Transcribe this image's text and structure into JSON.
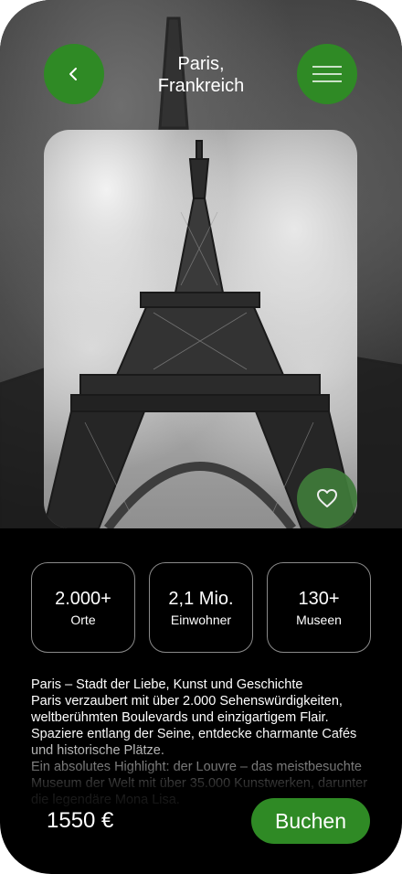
{
  "header": {
    "title_line1": "Paris,",
    "title_line2": "Frankreich"
  },
  "icons": {
    "back": "chevron-left-icon",
    "menu": "hamburger-menu-icon",
    "favorite": "heart-outline-icon"
  },
  "colors": {
    "accent": "#2f8a25",
    "background": "#000000",
    "text": "#ffffff"
  },
  "stats": [
    {
      "value": "2.000+",
      "label": "Orte"
    },
    {
      "value": "2,1 Mio.",
      "label": "Einwohner"
    },
    {
      "value": "130+",
      "label": "Museen"
    }
  ],
  "description": "Paris – Stadt der Liebe, Kunst und Geschichte\n Paris verzaubert mit über 2.000 Sehenswürdigkeiten, weltberühmten Boulevards und einzigartigem Flair. Spaziere entlang der Seine, entdecke charmante Cafés und historische Plätze.\n Ein absolutes Highlight: der Louvre – das meistbesuchte Museum der Welt mit über 35.000 Kunstwerken, darunter die legendäre Mona Lisa.",
  "footer": {
    "price": "1550 €",
    "book_label": "Buchen"
  }
}
